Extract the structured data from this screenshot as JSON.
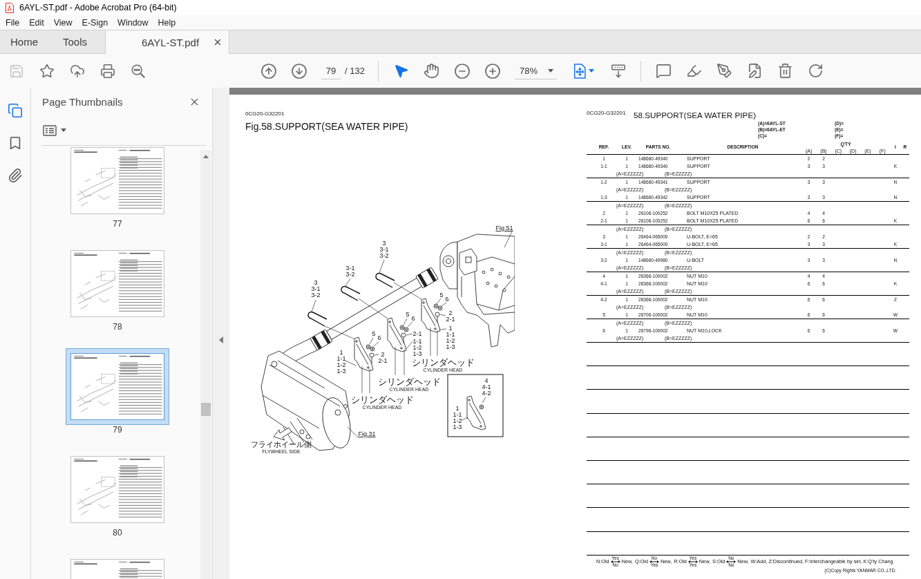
{
  "window": {
    "title": "6AYL-ST.pdf - Adobe Acrobat Pro (64-bit)"
  },
  "menu": [
    "File",
    "Edit",
    "View",
    "E-Sign",
    "Window",
    "Help"
  ],
  "tabs": [
    {
      "label": "Home",
      "selected": false
    },
    {
      "label": "Tools",
      "selected": false
    },
    {
      "label": "6AYL-ST.pdf",
      "selected": true
    }
  ],
  "toolbar": {
    "file_tools": [
      {
        "disabled": true
      },
      {
        "disabled": false
      },
      {
        "disabled": false
      },
      {
        "disabled": false
      },
      {
        "disabled": false
      }
    ],
    "page": {
      "value": "79",
      "total": "/ 132"
    },
    "view_tools": [
      {
        "selected": true
      },
      {
        "selected": false
      }
    ],
    "zoom": {
      "value": "78%"
    }
  },
  "nav_rail": [
    {
      "selected": true
    },
    {
      "selected": false
    },
    {
      "selected": false
    }
  ],
  "sidebar": {
    "title": "Page Thumbnails",
    "thumbnails": [
      {
        "label": "77",
        "selected": false
      },
      {
        "label": "78",
        "selected": false
      },
      {
        "label": "79",
        "selected": true
      },
      {
        "label": "80",
        "selected": false
      },
      {
        "selected": false
      }
    ]
  },
  "document": {
    "left_page": {
      "code": "0CG20-G32201",
      "title": "Fig.58.SUPPORT(SEA WATER PIPE)",
      "callouts": [
        {
          "kind": "figure_ref",
          "lines": [
            "Fig.51"
          ]
        },
        {
          "kind": "part",
          "lines": [
            "3",
            "3-1",
            "3-2"
          ]
        },
        {
          "kind": "part",
          "lines": [
            "3-1",
            "3-2"
          ]
        },
        {
          "kind": "part",
          "lines": [
            "3",
            "3-1",
            "3-2"
          ]
        },
        {
          "kind": "part",
          "lines": [
            "5"
          ]
        },
        {
          "kind": "part",
          "lines": [
            "6"
          ]
        },
        {
          "kind": "part",
          "lines": [
            "2",
            "2-1"
          ]
        },
        {
          "kind": "part",
          "lines": [
            "1",
            "1-1",
            "1-2",
            "1-3"
          ]
        },
        {
          "kind": "note",
          "lines": [
            "シリンダヘッド",
            "CYLINDER HEAD"
          ]
        },
        {
          "kind": "part",
          "lines": [
            "5"
          ]
        },
        {
          "kind": "part",
          "lines": [
            "6"
          ]
        },
        {
          "kind": "part",
          "lines": [
            "2-1"
          ]
        },
        {
          "kind": "part",
          "lines": [
            "1-1",
            "1-2",
            "1-3"
          ]
        },
        {
          "kind": "note",
          "lines": [
            "シリンダヘッド",
            "CYLINDER HEAD"
          ]
        },
        {
          "kind": "part",
          "lines": [
            "5"
          ]
        },
        {
          "kind": "part",
          "lines": [
            "6"
          ]
        },
        {
          "kind": "part",
          "lines": [
            "1",
            "1-1",
            "1-2",
            "1-3"
          ]
        },
        {
          "kind": "part",
          "lines": [
            "2",
            "2-1"
          ]
        },
        {
          "kind": "note",
          "lines": [
            "シリンダヘッド",
            "CYLINDER HEAD"
          ]
        },
        {
          "kind": "figure_ref",
          "lines": [
            "Fig.31"
          ]
        },
        {
          "kind": "direction",
          "lines": [
            "フライホイール側",
            "FLYWHEEL SIDE"
          ]
        },
        {
          "kind": "part",
          "lines": [
            "4",
            "4-1",
            "4-2"
          ]
        },
        {
          "kind": "part",
          "lines": [
            "1",
            "1-1",
            "1-2",
            "1-3"
          ]
        }
      ]
    },
    "right_page": {
      "code": "0CG20-G32201",
      "title": "58.SUPPORT(SEA WATER PIPE)",
      "models": [
        "(A)=6AYL-ST",
        "(D)=",
        "(B)=6AYL-ET",
        "(E)=",
        "(C)=",
        "(F)="
      ],
      "columns": {
        "ref": "REF.",
        "lev": "LEV.",
        "parts_no": "PARTS NO.",
        "description": "DESCRIPTION",
        "qty": "Q'TY",
        "qty_columns": [
          "(A)",
          "(B)",
          "(C)",
          "(D)",
          "(E)",
          "(F)"
        ],
        "i": "I",
        "r": "R"
      },
      "groups": [
        {
          "lines": [
            {
              "kind": "part",
              "ref": "1",
              "lev": "1",
              "parts_no": "148660-49340",
              "description": "SUPPORT",
              "qty": [
                "2",
                "2"
              ]
            },
            {
              "kind": "part",
              "ref": "1-1",
              "lev": "1",
              "parts_no": "148660-49340",
              "description": "SUPPORT",
              "qty": [
                "3",
                "3"
              ],
              "i": "K"
            },
            {
              "kind": "serial",
              "notes": [
                "(A=EZZZZZ)",
                "(B=EZZZZZ)"
              ]
            }
          ]
        },
        {
          "lines": [
            {
              "kind": "part",
              "ref": "1-2",
              "lev": "1",
              "parts_no": "148660-49341",
              "description": "SUPPORT",
              "qty": [
                "3",
                "3"
              ],
              "i": "N"
            },
            {
              "kind": "serial",
              "notes": [
                "(A=EZZZZZ)",
                "(B=EZZZZZ)"
              ]
            },
            {
              "kind": "part",
              "ref": "1-3",
              "lev": "1",
              "parts_no": "148660-49342",
              "description": "SUPPORT",
              "qty": [
                "3",
                "3"
              ],
              "i": "N"
            }
          ]
        },
        {
          "lines": [
            {
              "kind": "serial",
              "notes": [
                "(A=EZZZZZ)",
                "(B=EZZZZZ)"
              ]
            },
            {
              "kind": "part",
              "ref": "2",
              "lev": "1",
              "parts_no": "26106-100252",
              "description": "BOLT M10X25 PLATED",
              "qty": [
                "4",
                "4"
              ]
            },
            {
              "kind": "part",
              "ref": "2-1",
              "lev": "1",
              "parts_no": "26106-100252",
              "description": "BOLT M10X25 PLATED",
              "qty": [
                "6",
                "6"
              ],
              "i": "K"
            }
          ]
        },
        {
          "lines": [
            {
              "kind": "serial",
              "notes": [
                "(A=EZZZZZ)",
                "(B=EZZZZZ)"
              ]
            },
            {
              "kind": "part",
              "ref": "3",
              "lev": "1",
              "parts_no": "26464-065000",
              "description": "U-BOLT, E=65",
              "qty": [
                "2",
                "2"
              ]
            },
            {
              "kind": "part",
              "ref": "3-1",
              "lev": "1",
              "parts_no": "26464-065000",
              "description": "U-BOLT, E=65",
              "qty": [
                "3",
                "3"
              ],
              "i": "K"
            }
          ]
        },
        {
          "lines": [
            {
              "kind": "serial",
              "notes": [
                "(A=EZZZZZ)",
                "(B=EZZZZZ)"
              ]
            },
            {
              "kind": "part",
              "ref": "3-2",
              "lev": "1",
              "parts_no": "148660-49980",
              "description": "U-BOLT",
              "qty": [
                "3",
                "3"
              ],
              "i": "N"
            },
            {
              "kind": "serial",
              "notes": [
                "(A=EZZZZZ)",
                "(B=EZZZZZ)"
              ]
            }
          ]
        },
        {
          "lines": [
            {
              "kind": "part",
              "ref": "4",
              "lev": "1",
              "parts_no": "26366-100002",
              "description": "NUT M10",
              "qty": [
                "4",
                "4"
              ]
            },
            {
              "kind": "part",
              "ref": "4-1",
              "lev": "1",
              "parts_no": "26366-100002",
              "description": "NUT M10",
              "qty": [
                "6",
                "6"
              ],
              "i": "K"
            },
            {
              "kind": "serial",
              "notes": [
                "(A=EZZZZZ)",
                "(B=EZZZZZ)"
              ]
            }
          ]
        },
        {
          "lines": [
            {
              "kind": "part",
              "ref": "4-2",
              "lev": "1",
              "parts_no": "26366-100002",
              "description": "NUT M10",
              "qty": [
                "6",
                "6"
              ],
              "i": "Z"
            },
            {
              "kind": "serial",
              "notes": [
                "(A=EZZZZZ)",
                "(B=EZZZZZ)"
              ]
            },
            {
              "kind": "part",
              "ref": "5",
              "lev": "1",
              "parts_no": "26706-100002",
              "description": "NUT M10",
              "qty": [
                "6",
                "6"
              ],
              "i": "W"
            }
          ]
        },
        {
          "lines": [
            {
              "kind": "serial",
              "notes": [
                "(A=EZZZZZ)",
                "(B=EZZZZZ)"
              ]
            },
            {
              "kind": "part",
              "ref": "6",
              "lev": "1",
              "parts_no": "26796-100002",
              "description": "NUT M10,LOCK",
              "qty": [
                "6",
                "6"
              ],
              "i": "W"
            },
            {
              "kind": "serial",
              "notes": [
                "(A=EZZZZZ)",
                "(B=EZZZZZ)"
              ]
            }
          ]
        }
      ],
      "legend": [
        {
          "kind": "swap",
          "code": "N:Old",
          "upper": "Yes",
          "lower": "No",
          "result": "New,"
        },
        {
          "kind": "swap",
          "code": "Q:Old",
          "upper": "No",
          "lower": "Yes",
          "result": "New,"
        },
        {
          "kind": "swap",
          "code": "R:Old",
          "upper": "Yes",
          "lower": "Yes",
          "result": "New,"
        },
        {
          "kind": "swap",
          "code": "S:Old",
          "upper": "No",
          "lower": "No",
          "result": "New,"
        },
        {
          "kind": "text",
          "text": "W:Add, Z:Discontinued, F:Interchangeable by set, K:Q'ty Chang"
        }
      ],
      "copyright": "(C)Copy Rights YANMAR CO.,LTD."
    }
  }
}
